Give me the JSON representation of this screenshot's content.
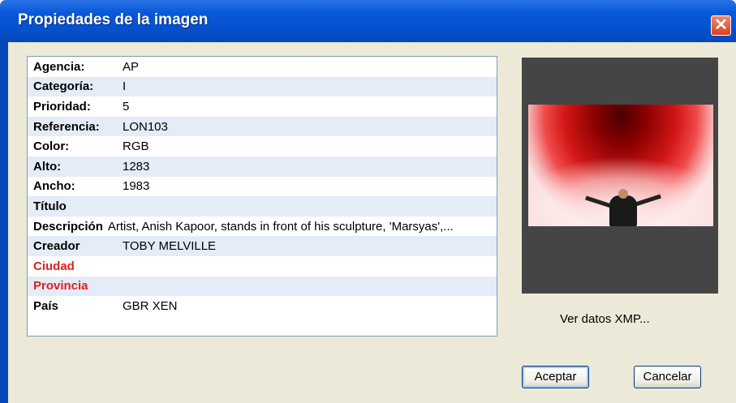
{
  "window": {
    "title": "Propiedades de la imagen",
    "close_glyph": "✕"
  },
  "properties": [
    {
      "label": "Agencia:",
      "value": "AP"
    },
    {
      "label": "Categoría:",
      "value": "I"
    },
    {
      "label": "Prioridad:",
      "value": "5"
    },
    {
      "label": "Referencia:",
      "value": "LON103"
    },
    {
      "label": "Color:",
      "value": "RGB"
    },
    {
      "label": "Alto:",
      "value": "1283"
    },
    {
      "label": "Ancho:",
      "value": "1983"
    },
    {
      "label": "Título",
      "value": ""
    },
    {
      "label": "Descripción",
      "value": "Artist, Anish Kapoor, stands in front of his sculpture, 'Marsyas',..."
    },
    {
      "label": "Creador",
      "value": "TOBY MELVILLE"
    },
    {
      "label": "Ciudad",
      "value": ""
    },
    {
      "label": "Provincia",
      "value": ""
    },
    {
      "label": "País",
      "value": "GBR XEN"
    }
  ],
  "preview": {
    "xmp_link": "Ver datos XMP..."
  },
  "buttons": {
    "accept": "Aceptar",
    "cancel": "Cancelar"
  },
  "colors": {
    "title_bar": "#0550cc",
    "required_label": "#e02020",
    "alt_row": "#e4ecf7",
    "dialog_bg": "#ece9d8"
  }
}
